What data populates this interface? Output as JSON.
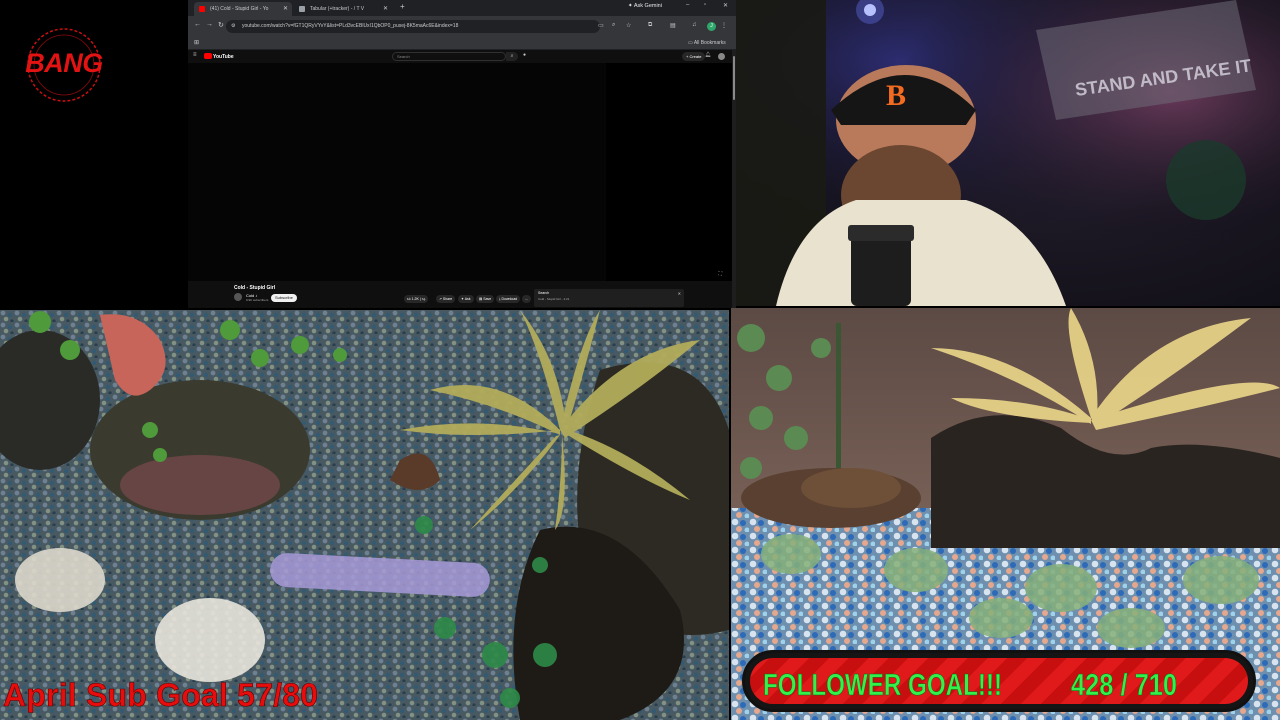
{
  "logo": {
    "text": "BANG",
    "color": "#e41313"
  },
  "browser": {
    "tabs": [
      {
        "label": "(41) Cold - Stupid Girl - Yo",
        "favicon": "youtube-favicon",
        "active": true
      },
      {
        "label": "Tabular (+tracker) - / T V",
        "favicon": "twitch-favicon",
        "active": false
      }
    ],
    "new_tab": "+",
    "ask_gemini": "Ask Gemini",
    "url": "youtube.com/watch?v=fGT1QRyVYvY&list=PLd3vcEBlUxI1QbOP0_pusej-8K5maAc6E&index=18",
    "profile_initial": "J",
    "all_bookmarks": "All Bookmarks"
  },
  "youtube": {
    "logo_text": "YouTube",
    "search_placeholder": "Search",
    "create_label": "+ Create",
    "video_title": "Cold - Stupid Girl",
    "channel": "Cold ♪",
    "subscribers": "9.9K subscribers",
    "subscribe_label": "Subscribe",
    "actions": {
      "like": "1.2K",
      "share": "Share",
      "ask": "Ask",
      "save": "Save",
      "download": "Download",
      "more": "..."
    },
    "comment_box": {
      "title": "Search",
      "subtitle": "Cold - Stupid Girl - 4:21"
    }
  },
  "overlays": {
    "sub_goal": "April Sub Goal 57/80",
    "follower_goal_label": "FOLLOWER GOAL!!!",
    "follower_goal_count": "428 / 710",
    "follower_current": 428,
    "follower_target": 710,
    "colors": {
      "sub_goal": "#e80d0d",
      "follower_text": "#33f04a",
      "follower_bar": "#e01a1a"
    }
  },
  "webcam": {
    "sign_text": "STAND AND TAKE IT"
  }
}
